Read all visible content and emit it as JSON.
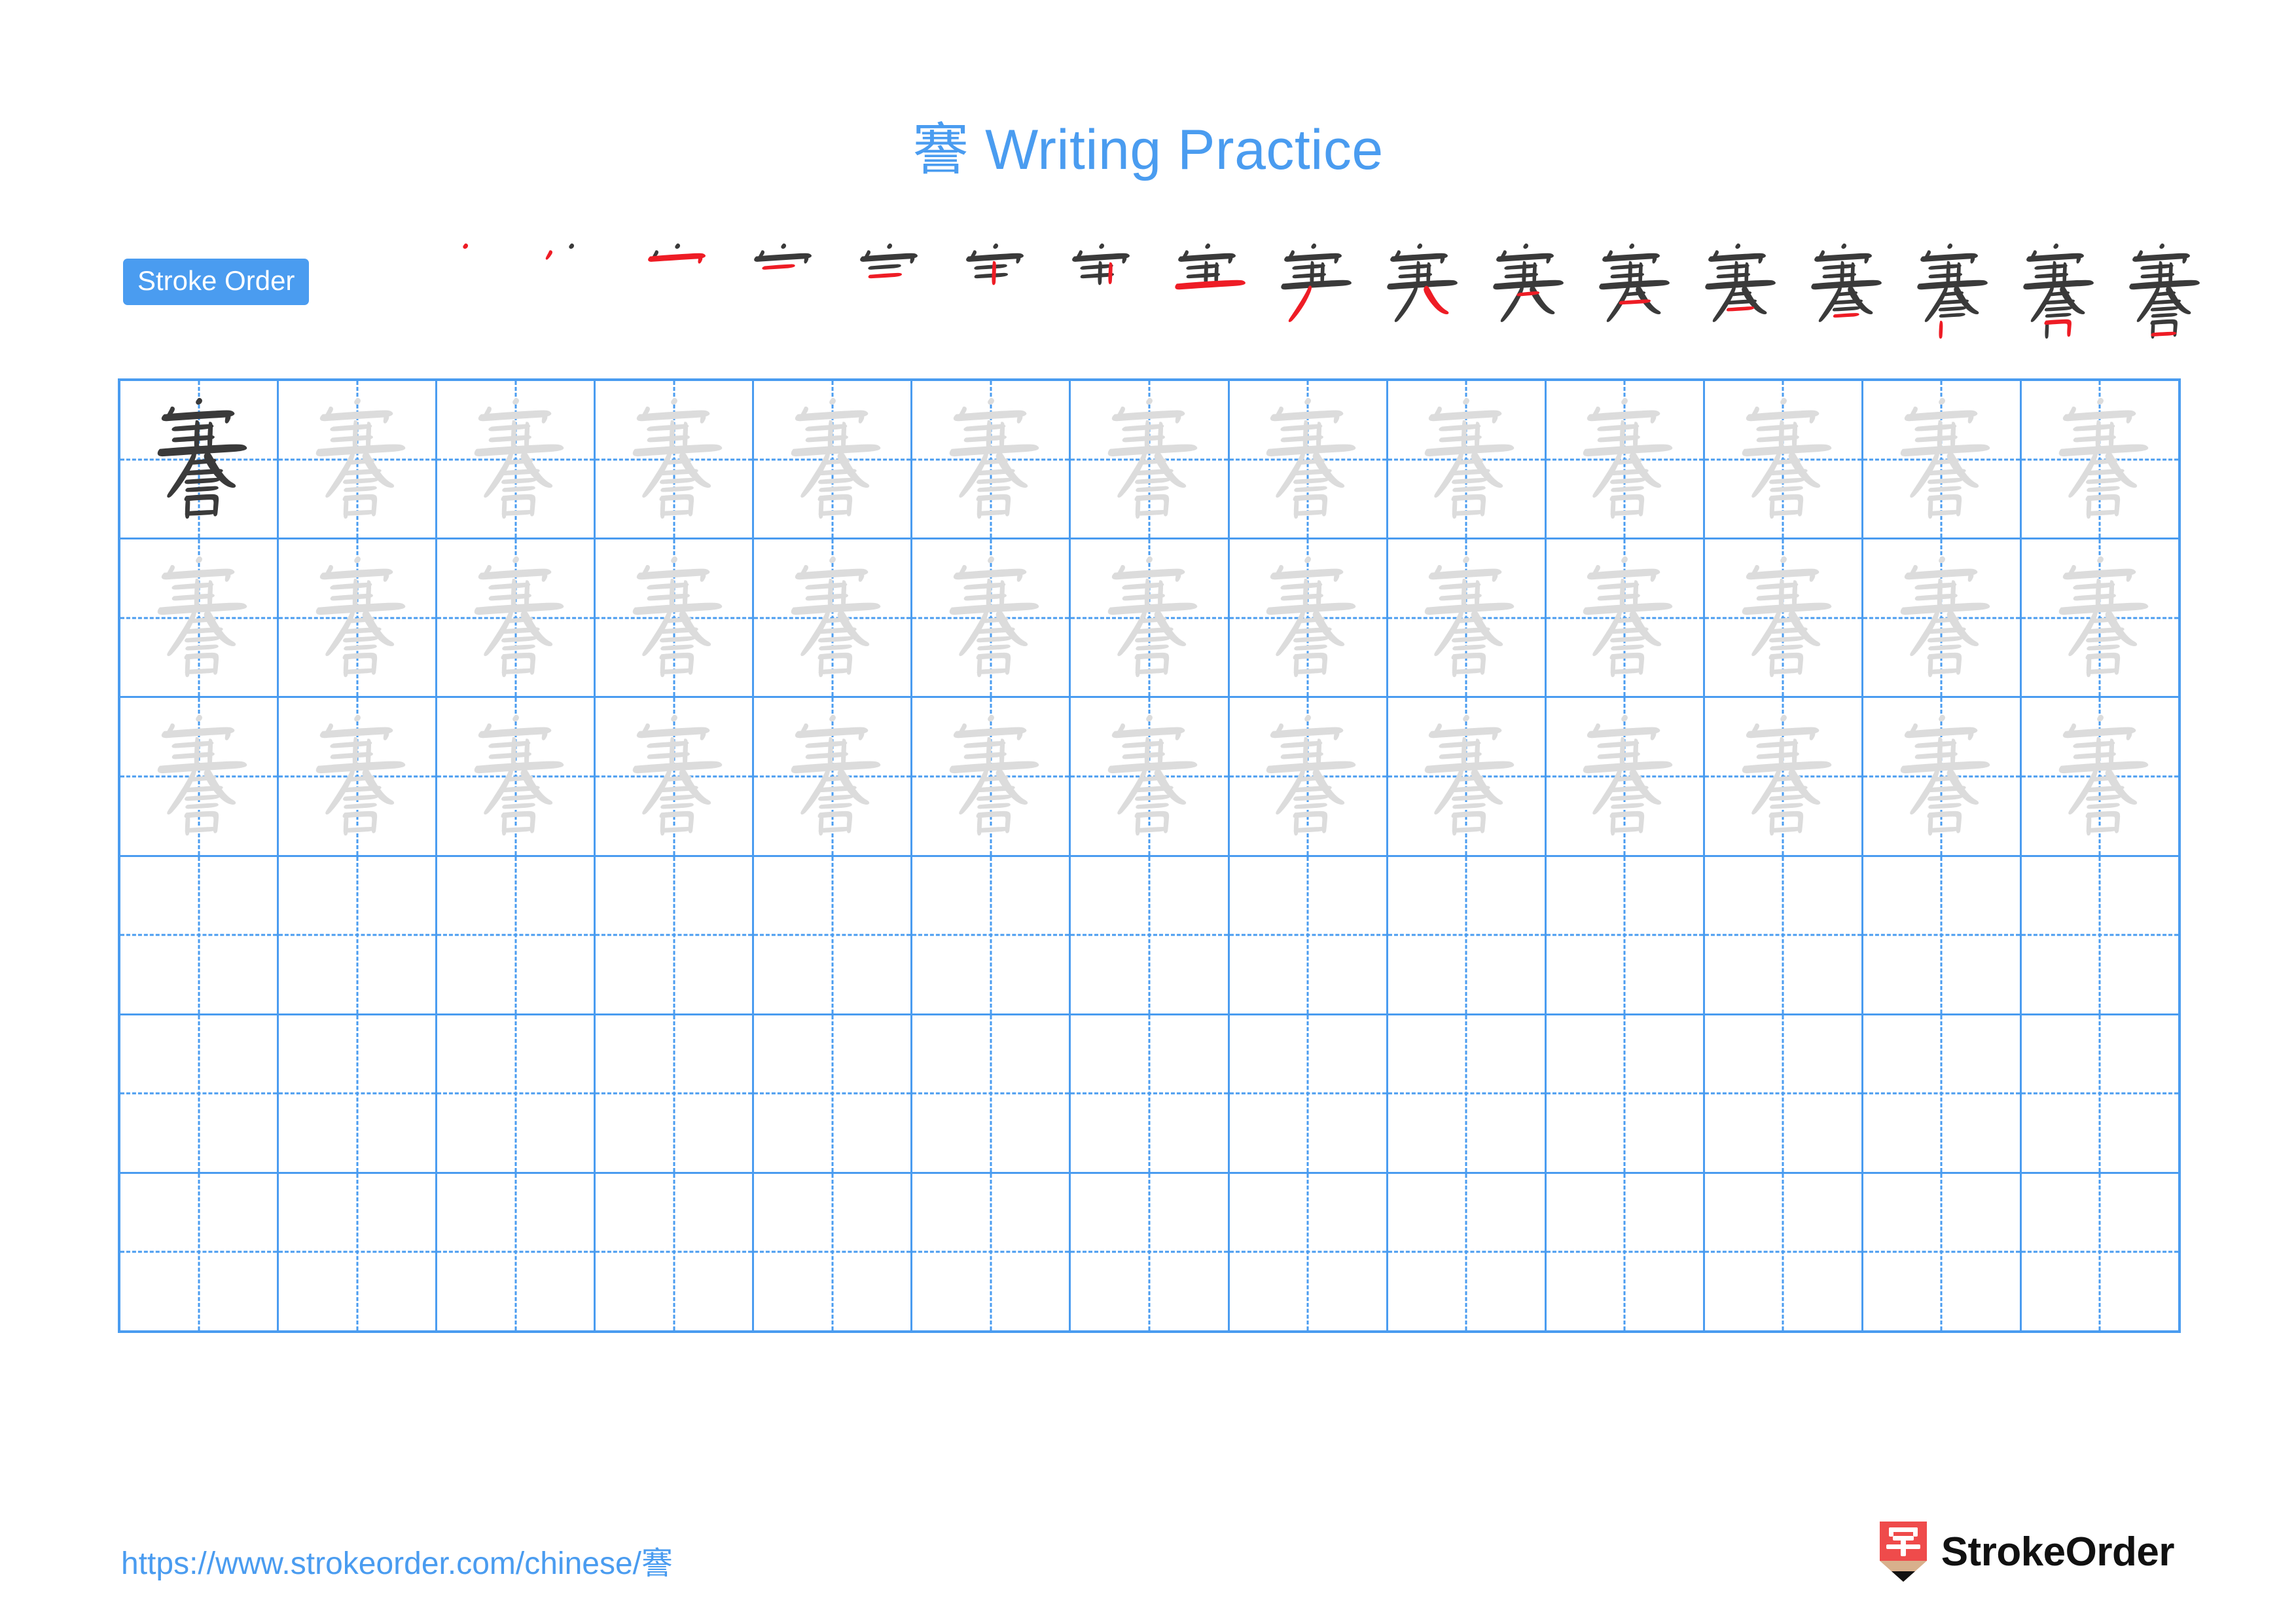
{
  "document": {
    "type": "chinese-character-writing-practice-worksheet",
    "character": "謇",
    "stroke_count": 17,
    "title": "謇 Writing Practice",
    "title_character": "謇",
    "title_text": " Writing Practice"
  },
  "colors": {
    "accent_blue": "#4a9cf0",
    "grid_blue": "#4a9cf0",
    "stroke_highlight_red": "#ee1c25",
    "stroke_ink_dark": "#3a3a3a",
    "trace_grey": "#dcdcdc",
    "logo_red": "#ef4b4b",
    "logo_wood": "#d8b08c",
    "logo_text": "#111111"
  },
  "stroke_order": {
    "badge_label": "Stroke Order",
    "steps": [
      {
        "index": 1,
        "character": "謇",
        "strokes_drawn": 1,
        "new_stroke_color": "#ee1c25"
      },
      {
        "index": 2,
        "character": "謇",
        "strokes_drawn": 2,
        "new_stroke_color": "#ee1c25"
      },
      {
        "index": 3,
        "character": "謇",
        "strokes_drawn": 3,
        "new_stroke_color": "#ee1c25"
      },
      {
        "index": 4,
        "character": "謇",
        "strokes_drawn": 4,
        "new_stroke_color": "#ee1c25"
      },
      {
        "index": 5,
        "character": "謇",
        "strokes_drawn": 5,
        "new_stroke_color": "#ee1c25"
      },
      {
        "index": 6,
        "character": "謇",
        "strokes_drawn": 6,
        "new_stroke_color": "#ee1c25"
      },
      {
        "index": 7,
        "character": "謇",
        "strokes_drawn": 7,
        "new_stroke_color": "#ee1c25"
      },
      {
        "index": 8,
        "character": "謇",
        "strokes_drawn": 8,
        "new_stroke_color": "#ee1c25"
      },
      {
        "index": 9,
        "character": "謇",
        "strokes_drawn": 9,
        "new_stroke_color": "#ee1c25"
      },
      {
        "index": 10,
        "character": "謇",
        "strokes_drawn": 10,
        "new_stroke_color": "#ee1c25"
      },
      {
        "index": 11,
        "character": "謇",
        "strokes_drawn": 11,
        "new_stroke_color": "#ee1c25"
      },
      {
        "index": 12,
        "character": "謇",
        "strokes_drawn": 12,
        "new_stroke_color": "#ee1c25"
      },
      {
        "index": 13,
        "character": "謇",
        "strokes_drawn": 13,
        "new_stroke_color": "#ee1c25"
      },
      {
        "index": 14,
        "character": "謇",
        "strokes_drawn": 14,
        "new_stroke_color": "#ee1c25"
      },
      {
        "index": 15,
        "character": "謇",
        "strokes_drawn": 15,
        "new_stroke_color": "#ee1c25"
      },
      {
        "index": 16,
        "character": "謇",
        "strokes_drawn": 16,
        "new_stroke_color": "#ee1c25"
      },
      {
        "index": 17,
        "character": "謇",
        "strokes_drawn": 17,
        "new_stroke_color": "#ee1c25"
      }
    ]
  },
  "practice_grid": {
    "columns": 13,
    "rows": 6,
    "cell_guides": "dashed-cross",
    "row_data": [
      {
        "row": 1,
        "cells": [
          "dark",
          "light",
          "light",
          "light",
          "light",
          "light",
          "light",
          "light",
          "light",
          "light",
          "light",
          "light",
          "light"
        ]
      },
      {
        "row": 2,
        "cells": [
          "light",
          "light",
          "light",
          "light",
          "light",
          "light",
          "light",
          "light",
          "light",
          "light",
          "light",
          "light",
          "light"
        ]
      },
      {
        "row": 3,
        "cells": [
          "light",
          "light",
          "light",
          "light",
          "light",
          "light",
          "light",
          "light",
          "light",
          "light",
          "light",
          "light",
          "light"
        ]
      },
      {
        "row": 4,
        "cells": [
          "empty",
          "empty",
          "empty",
          "empty",
          "empty",
          "empty",
          "empty",
          "empty",
          "empty",
          "empty",
          "empty",
          "empty",
          "empty"
        ]
      },
      {
        "row": 5,
        "cells": [
          "empty",
          "empty",
          "empty",
          "empty",
          "empty",
          "empty",
          "empty",
          "empty",
          "empty",
          "empty",
          "empty",
          "empty",
          "empty"
        ]
      },
      {
        "row": 6,
        "cells": [
          "empty",
          "empty",
          "empty",
          "empty",
          "empty",
          "empty",
          "empty",
          "empty",
          "empty",
          "empty",
          "empty",
          "empty",
          "empty"
        ]
      }
    ]
  },
  "footer": {
    "url": "https://www.strokeorder.com/chinese/謇",
    "logo_character": "字",
    "logo_wordmark": "StrokeOrder"
  }
}
